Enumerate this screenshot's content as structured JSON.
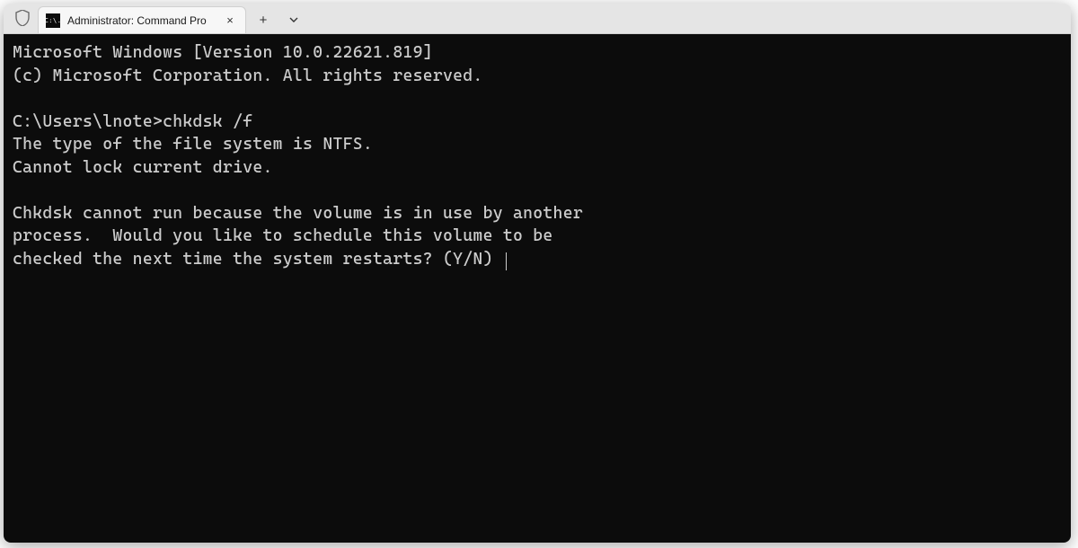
{
  "titlebar": {
    "tab_title": "Administrator: Command Pro",
    "tab_icon_text": "C:\\.",
    "new_tab_symbol": "+",
    "close_symbol": "×"
  },
  "terminal": {
    "lines": [
      "Microsoft Windows [Version 10.0.22621.819]",
      "(c) Microsoft Corporation. All rights reserved.",
      "",
      "C:\\Users\\lnote>chkdsk /f",
      "The type of the file system is NTFS.",
      "Cannot lock current drive.",
      "",
      "Chkdsk cannot run because the volume is in use by another",
      "process.  Would you like to schedule this volume to be",
      "checked the next time the system restarts? (Y/N) "
    ]
  }
}
